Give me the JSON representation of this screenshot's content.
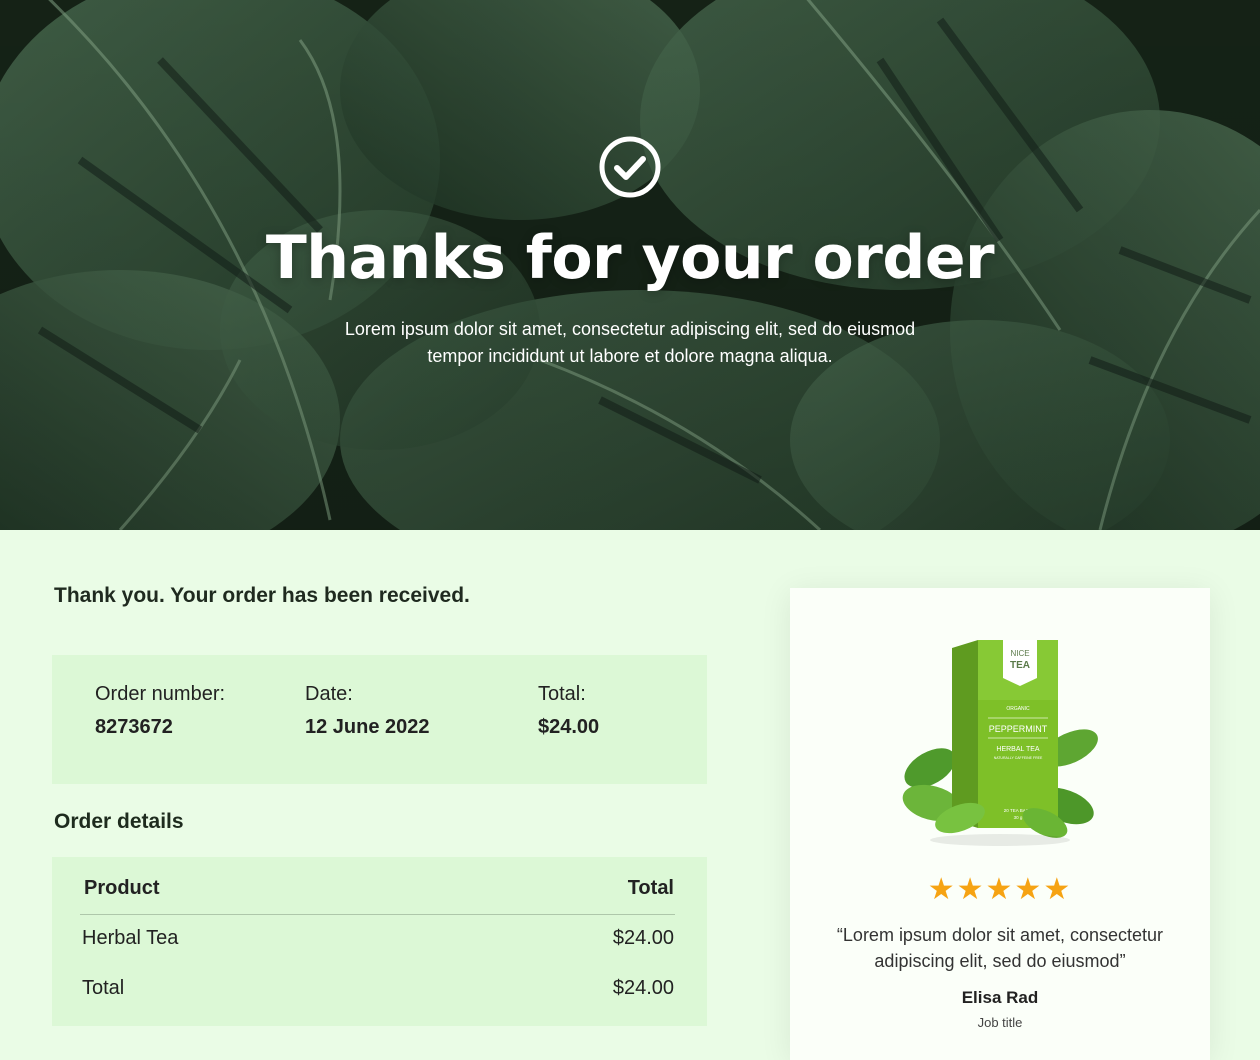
{
  "hero": {
    "title": "Thanks for your order",
    "subtitle": "Lorem ipsum dolor sit amet, consectetur adipiscing elit, sed do eiusmod tempor incididunt ut labore et dolore magna aliqua.",
    "icon": "check-circle-icon"
  },
  "order": {
    "received_message": "Thank you. Your order has been received.",
    "number_label": "Order number:",
    "number_value": "8273672",
    "date_label": "Date:",
    "date_value": "12 June 2022",
    "total_label": "Total:",
    "total_value": "$24.00"
  },
  "details": {
    "title": "Order details",
    "header": {
      "product": "Product",
      "total": "Total"
    },
    "rows": [
      {
        "product": "Herbal Tea",
        "total": "$24.00"
      },
      {
        "product": "Total",
        "total": "$24.00"
      }
    ]
  },
  "review": {
    "product_box": {
      "brand_line1": "NICE",
      "brand_line2": "TEA",
      "tag": "ORGANIC",
      "flavor": "PEPPERMINT",
      "type": "HERBAL TEA",
      "subtitle": "NATURALLY CAFFEINE FREE",
      "pack_line1": "20 TEA BAGS",
      "pack_line2": "30 g"
    },
    "rating": 5,
    "stars": "★★★★★",
    "quote": "“Lorem ipsum dolor sit amet, consectetur adipiscing elit, sed do eiusmod”",
    "author": "Elisa Rad",
    "job_title": "Job title"
  },
  "colors": {
    "page_bg": "#eafce6",
    "panel_bg": "#dcf8d6",
    "star": "#f6a313",
    "box_green": "#7ec028"
  }
}
